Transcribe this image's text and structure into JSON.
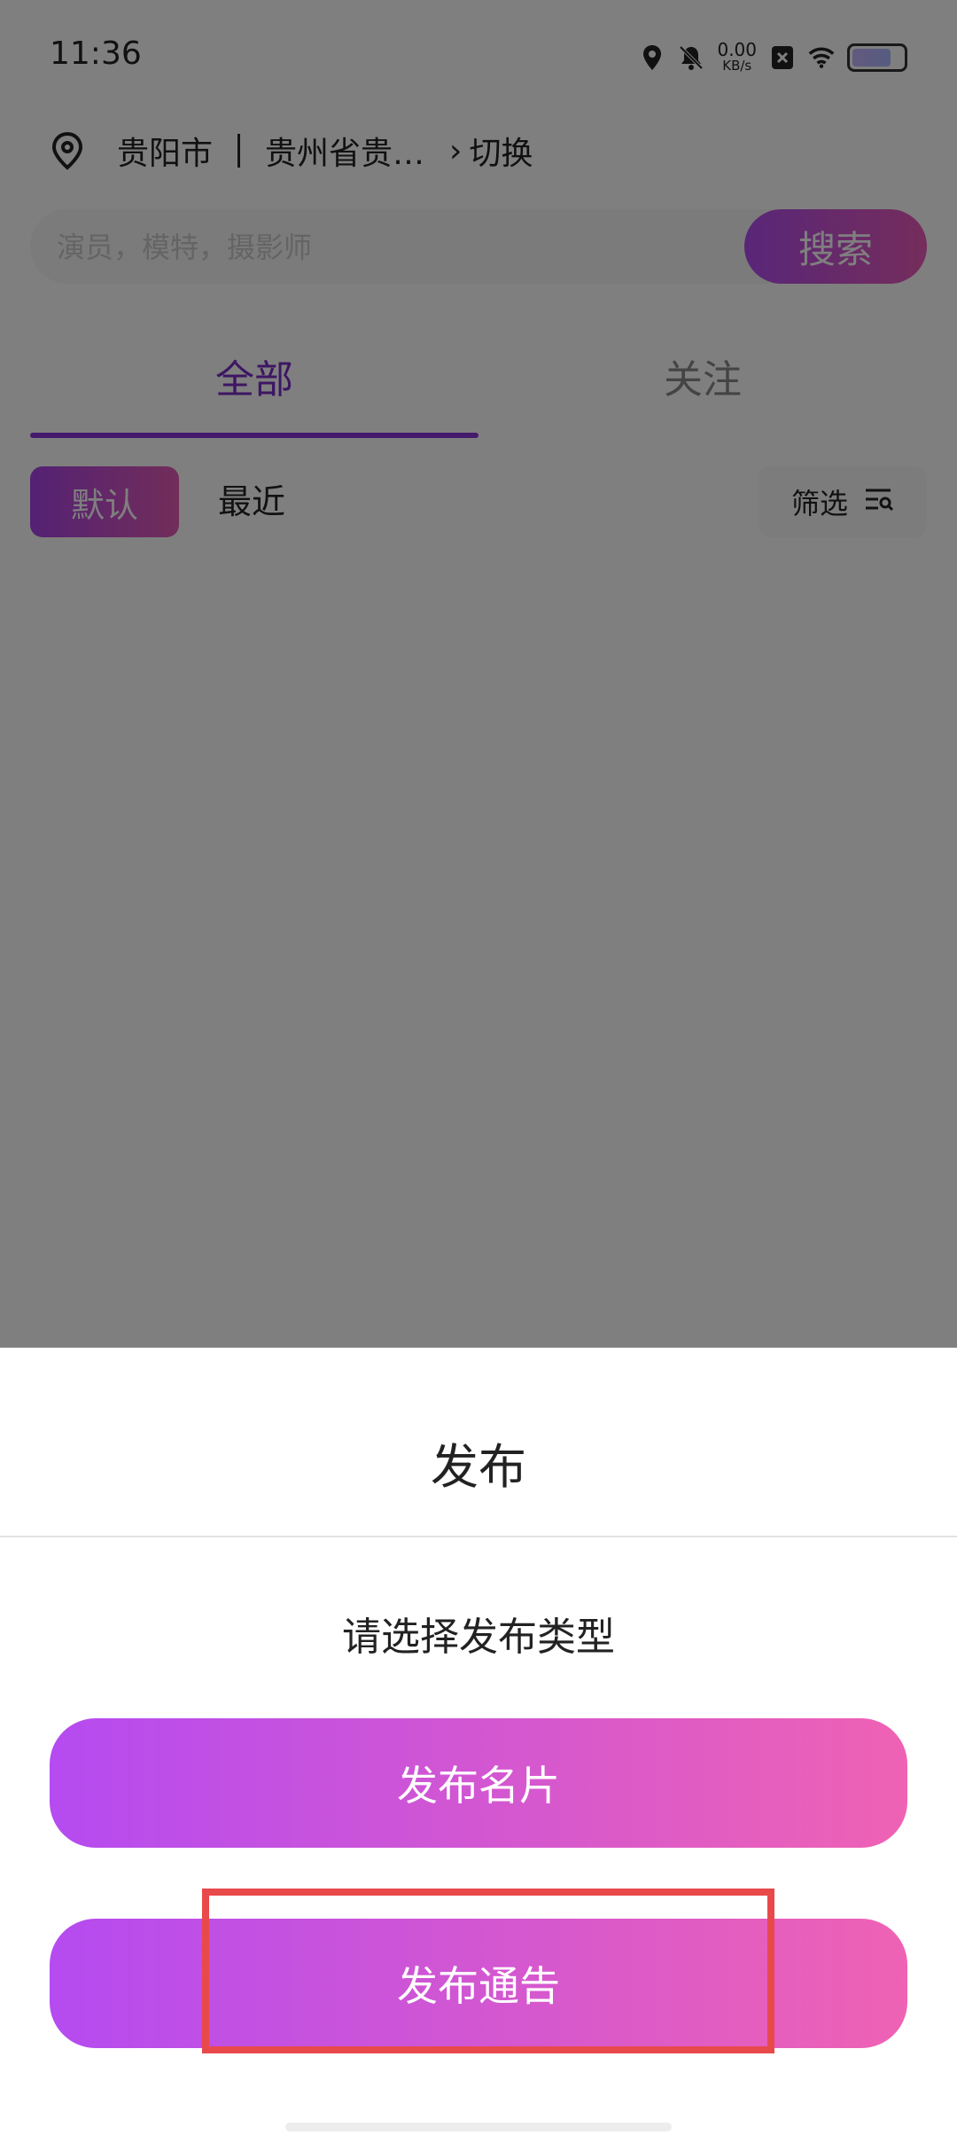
{
  "status_bar": {
    "time": "11:36",
    "net_speed_value": "0.00",
    "net_speed_unit": "KB/s"
  },
  "location": {
    "city": "贵阳市",
    "address": "贵州省贵…",
    "switch_label": "切换"
  },
  "search": {
    "placeholder": "演员，模特，摄影师",
    "button_label": "搜索"
  },
  "tabs": [
    {
      "label": "全部",
      "active": true
    },
    {
      "label": "关注",
      "active": false
    }
  ],
  "sort": {
    "default_label": "默认",
    "recent_label": "最近",
    "filter_label": "筛选"
  },
  "sheet": {
    "title": "发布",
    "subtitle": "请选择发布类型",
    "buttons": [
      {
        "label": "发布名片"
      },
      {
        "label": "发布通告"
      }
    ]
  },
  "colors": {
    "accent": "#8a35d9",
    "gradient_start": "#b54bf0",
    "gradient_end": "#ef62b4",
    "highlight_box": "#e8494b"
  }
}
